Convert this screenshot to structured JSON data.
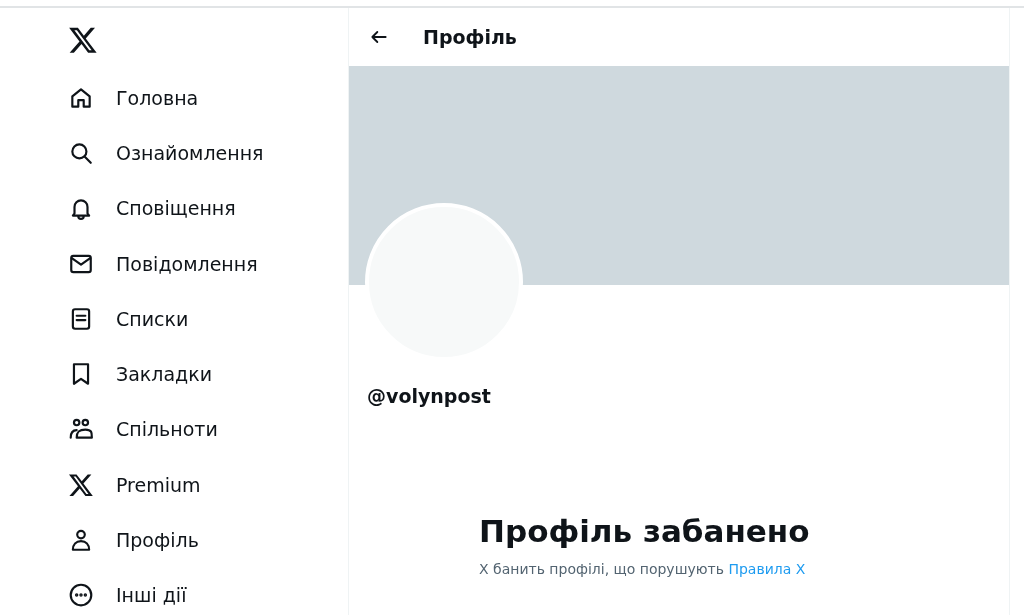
{
  "sidebar": {
    "items": [
      {
        "label": "Головна"
      },
      {
        "label": "Ознайомлення"
      },
      {
        "label": "Сповіщення"
      },
      {
        "label": "Повідомлення"
      },
      {
        "label": "Списки"
      },
      {
        "label": "Закладки"
      },
      {
        "label": "Спільноти"
      },
      {
        "label": "Premium"
      },
      {
        "label": "Профіль"
      },
      {
        "label": "Інші дії"
      }
    ]
  },
  "header": {
    "title": "Профіль"
  },
  "profile": {
    "handle": "@volynpost"
  },
  "notice": {
    "title": "Профіль забанено",
    "text": "X банить профілі, що порушують",
    "link": "Правила X"
  }
}
